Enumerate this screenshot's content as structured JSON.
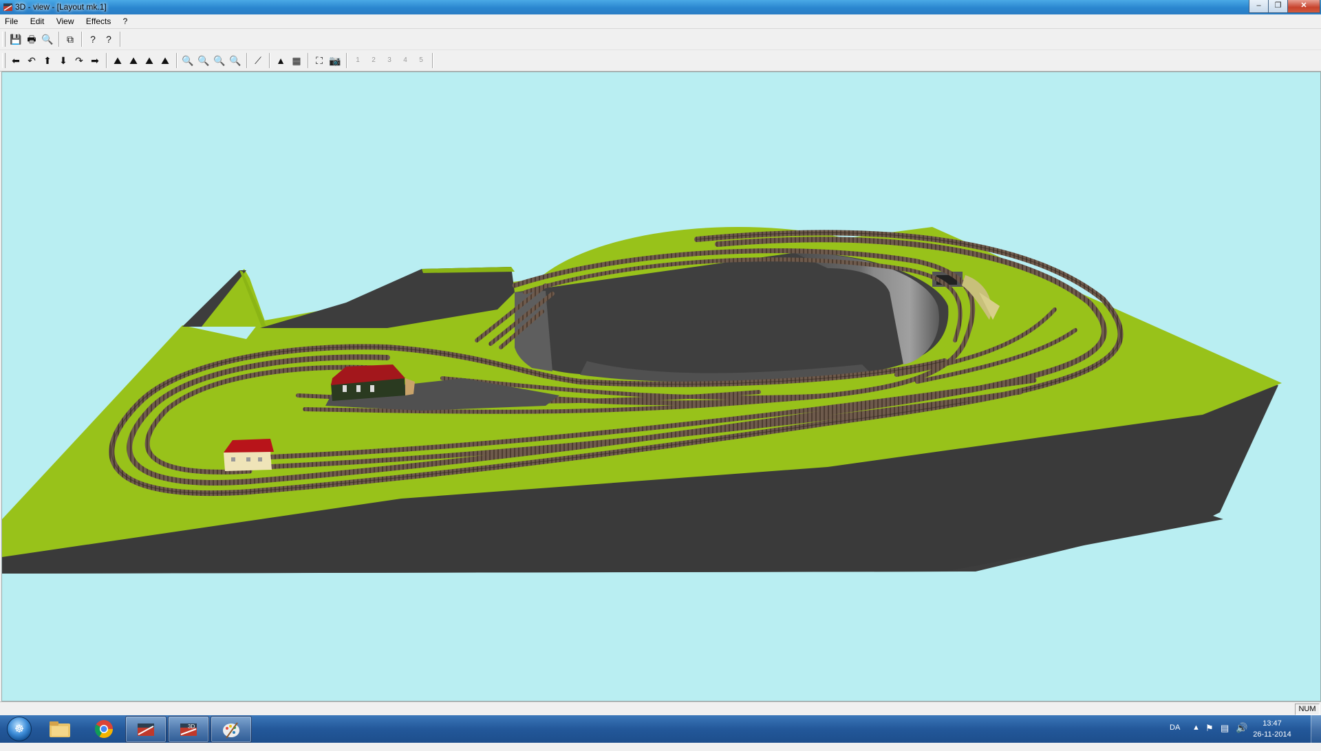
{
  "window": {
    "title": "3D - view - [Layout mk.1]",
    "controls": [
      "minimize",
      "maximize",
      "close"
    ]
  },
  "menu": [
    "File",
    "Edit",
    "View",
    "Effects",
    "?"
  ],
  "toolbar1": [
    {
      "name": "save-icon",
      "glyph": "💾"
    },
    {
      "name": "print-icon",
      "glyph": "🖶"
    },
    {
      "name": "print-preview-icon",
      "glyph": "🔍"
    },
    {
      "name": "copy-icon",
      "glyph": "⧉"
    },
    {
      "name": "help-icon",
      "glyph": "?"
    },
    {
      "name": "context-help-icon",
      "glyph": "?"
    }
  ],
  "toolbar2": [
    {
      "name": "arrow-left-icon",
      "glyph": "⬅"
    },
    {
      "name": "rotate-left-icon",
      "glyph": "↶"
    },
    {
      "name": "arrow-up-icon",
      "glyph": "⬆"
    },
    {
      "name": "arrow-down-icon",
      "glyph": "⬇"
    },
    {
      "name": "rotate-right-icon",
      "glyph": "↷"
    },
    {
      "name": "arrow-right-icon",
      "glyph": "➡"
    },
    {
      "name": "tilt-view-1-icon",
      "glyph": "⛰"
    },
    {
      "name": "tilt-view-2-icon",
      "glyph": "⛰"
    },
    {
      "name": "tilt-view-3-icon",
      "glyph": "⛰"
    },
    {
      "name": "tilt-view-4-icon",
      "glyph": "⛰"
    },
    {
      "name": "zoom-out-icon",
      "glyph": "🔍"
    },
    {
      "name": "zoom-out-2-icon",
      "glyph": "🔍"
    },
    {
      "name": "zoom-in-icon",
      "glyph": "🔍"
    },
    {
      "name": "zoom-in-2-icon",
      "glyph": "🔍"
    },
    {
      "name": "track-icon",
      "glyph": "⟋"
    },
    {
      "name": "terrain-icon",
      "glyph": "▲"
    },
    {
      "name": "grid-icon",
      "glyph": "▦"
    },
    {
      "name": "fit-view-icon",
      "glyph": "⛶"
    },
    {
      "name": "camera-icon",
      "glyph": "📷"
    },
    {
      "name": "train-1-icon",
      "glyph": "1"
    },
    {
      "name": "train-2-icon",
      "glyph": "2"
    },
    {
      "name": "train-3-icon",
      "glyph": "3"
    },
    {
      "name": "train-4-icon",
      "glyph": "4"
    },
    {
      "name": "train-5-icon",
      "glyph": "5"
    }
  ],
  "scene": {
    "sky_color": "#b9eef2",
    "grass_color": "#98c21a",
    "base_color": "#3d3d3d",
    "track_color": "#6e5a4c",
    "roof_color": "#a3171c"
  },
  "status": {
    "num": "NUM"
  },
  "taskbar": {
    "apps": [
      {
        "name": "explorer-icon"
      },
      {
        "name": "chrome-icon"
      },
      {
        "name": "wintrack-icon"
      },
      {
        "name": "wintrack-3d-icon"
      },
      {
        "name": "paint-icon"
      }
    ],
    "language": "DA",
    "time": "13:47",
    "date": "26-11-2014"
  }
}
